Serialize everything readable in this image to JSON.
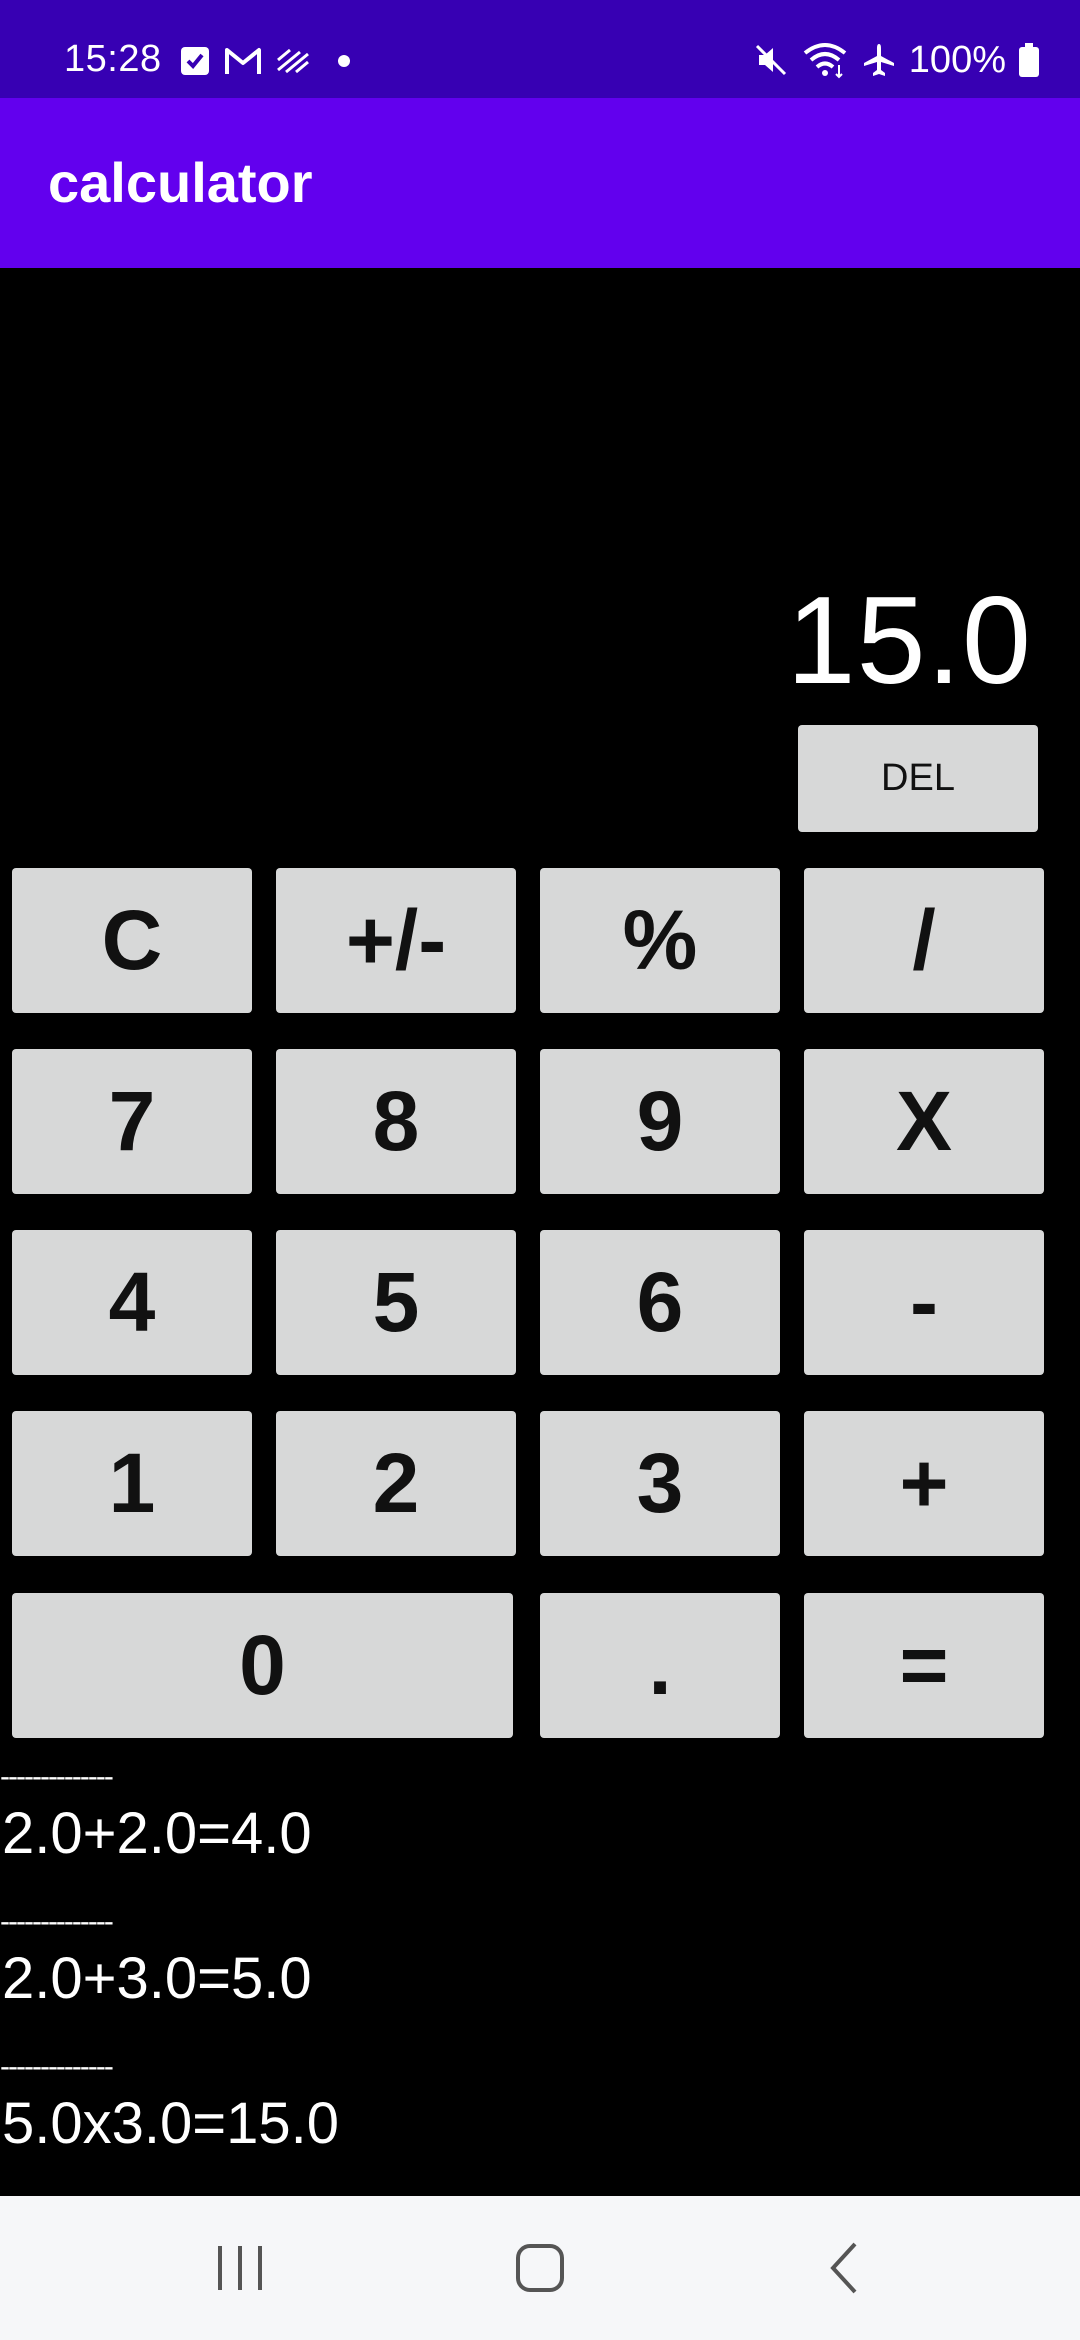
{
  "status_bar": {
    "time": "15:28",
    "battery": "100%",
    "left_icons": [
      "checkbox-icon",
      "gmail-icon",
      "stripes-icon",
      "dot-icon"
    ],
    "right_icons": [
      "mute-icon",
      "wifi-icon",
      "airplane-icon",
      "battery-icon"
    ]
  },
  "app_bar": {
    "title": "calculator"
  },
  "display": {
    "value": "15.0",
    "del_label": "DEL"
  },
  "keypad": {
    "c": "C",
    "sign": "+/-",
    "percent": "%",
    "divide": "/",
    "seven": "7",
    "eight": "8",
    "nine": "9",
    "multiply": "X",
    "four": "4",
    "five": "5",
    "six": "6",
    "minus": "-",
    "one": "1",
    "two": "2",
    "three": "3",
    "plus": "+",
    "zero": "0",
    "dot": ".",
    "equals": "="
  },
  "history": {
    "separator": "--------------",
    "entries": [
      "2.0+2.0=4.0",
      "2.0+3.0=5.0",
      "5.0x3.0=15.0"
    ]
  },
  "colors": {
    "status_bar": "#3700b3",
    "app_bar": "#6200ee",
    "background": "#000000",
    "button": "#d7d8d8",
    "nav_bar": "#f6f7f9"
  },
  "nav_bar": {
    "icons": [
      "recents-icon",
      "home-icon",
      "back-icon"
    ]
  }
}
